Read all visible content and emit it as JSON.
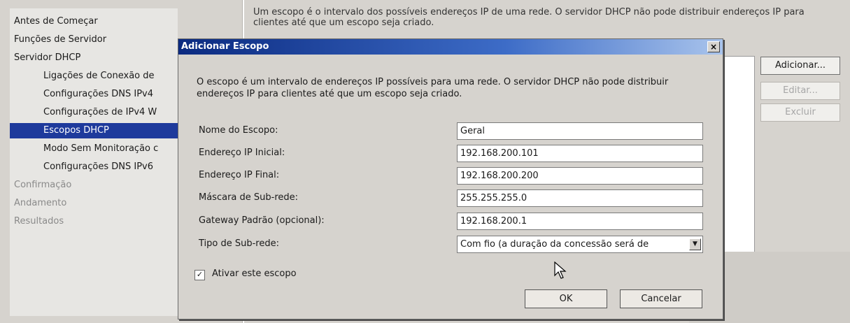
{
  "sidebar": {
    "items": [
      {
        "label": "Antes de Começar"
      },
      {
        "label": "Funções de Servidor"
      },
      {
        "label": "Servidor DHCP"
      },
      {
        "label": "Ligações de Conexão de"
      },
      {
        "label": "Configurações DNS IPv4"
      },
      {
        "label": "Configurações de IPv4 W"
      },
      {
        "label": "Escopos DHCP"
      },
      {
        "label": "Modo Sem Monitoração c"
      },
      {
        "label": "Configurações DNS IPv6"
      },
      {
        "label": "Confirmação"
      },
      {
        "label": "Andamento"
      },
      {
        "label": "Resultados"
      }
    ]
  },
  "main": {
    "description": "Um escopo é o intervalo dos possíveis endereços IP de uma rede. O servidor DHCP não pode distribuir endereços IP para clientes até que um escopo seja criado.",
    "buttons": {
      "add": "Adicionar...",
      "edit": "Editar...",
      "delete": "Excluir"
    }
  },
  "dialog": {
    "title": "Adicionar Escopo",
    "close_glyph": "×",
    "description": "O escopo é um intervalo de endereços IP possíveis para uma rede. O servidor DHCP não pode distribuir endereços IP para clientes até que um escopo seja criado.",
    "fields": {
      "scope_name": {
        "label": "Nome do Escopo:",
        "value": "Geral"
      },
      "start_ip": {
        "label": "Endereço IP Inicial:",
        "value": "192.168.200.101"
      },
      "end_ip": {
        "label": "Endereço IP Final:",
        "value": "192.168.200.200"
      },
      "subnet_mask": {
        "label": "Máscara de Sub-rede:",
        "value": "255.255.255.0"
      },
      "gateway": {
        "label": "Gateway Padrão (opcional):",
        "value": "192.168.200.1"
      },
      "subnet_type": {
        "label": "Tipo de Sub-rede:",
        "value": "Com fio (a duração da concessão será de"
      }
    },
    "activate_checkbox": {
      "label": "Ativar este escopo",
      "checked": true,
      "glyph": "✓"
    },
    "ok_label": "OK",
    "cancel_label": "Cancelar",
    "dropdown_glyph": "▼"
  },
  "icons": {
    "close": "close-icon",
    "dropdown": "chevron-down-icon",
    "cursor": "mouse-pointer-icon"
  },
  "colors": {
    "selection": "#1e3a9c",
    "titlebar_start": "#0b2a80",
    "titlebar_end": "#a9c4ec"
  }
}
